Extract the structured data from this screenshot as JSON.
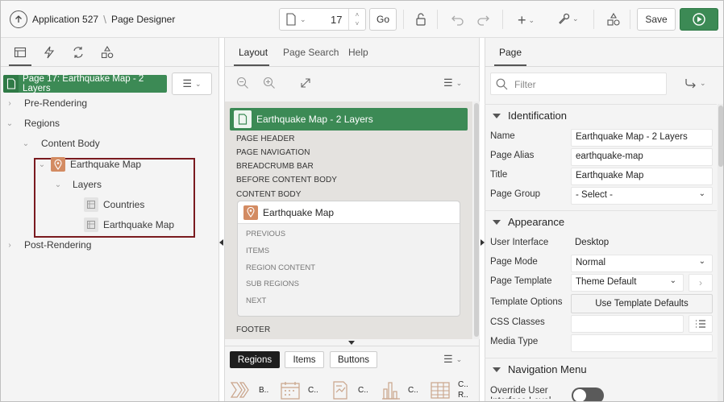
{
  "toolbar": {
    "app_name": "Application 527",
    "separator": "\\",
    "designer_title": "Page Designer",
    "page_number": "17",
    "go_label": "Go",
    "save_label": "Save",
    "colors": {
      "green": "#3c8a55",
      "dark_green": "#2f7a46"
    }
  },
  "left_panel": {
    "tabs": [
      "rendering-icon",
      "dynamic-actions-icon",
      "processing-icon",
      "shared-components-icon"
    ],
    "page_header": "Page 17: Earthquake Map - 2 Layers",
    "tree": {
      "pre_rendering": "Pre-Rendering",
      "regions": "Regions",
      "content_body": "Content Body",
      "earthquake_map": "Earthquake Map",
      "layers": "Layers",
      "countries": "Countries",
      "earthquake_map_layer": "Earthquake Map",
      "post_rendering": "Post-Rendering"
    }
  },
  "middle_panel": {
    "tabs": [
      "Layout",
      "Page Search",
      "Help"
    ],
    "page_title": "Earthquake Map - 2 Layers",
    "positions": {
      "page_header": "PAGE HEADER",
      "page_navigation": "PAGE NAVIGATION",
      "breadcrumb_bar": "BREADCRUMB BAR",
      "before_content_body": "BEFORE CONTENT BODY",
      "content_body": "CONTENT BODY",
      "footer": "FOOTER"
    },
    "region_card": {
      "title": "Earthquake Map",
      "sub_positions": [
        "PREVIOUS",
        "ITEMS",
        "REGION CONTENT",
        "SUB REGIONS",
        "NEXT"
      ]
    },
    "gallery_tabs": [
      "Regions",
      "Items",
      "Buttons"
    ],
    "gallery_items": [
      "B..",
      "C..",
      "C..",
      "C..",
      "C.. R.."
    ]
  },
  "right_panel": {
    "tab": "Page",
    "filter_placeholder": "Filter",
    "identification": {
      "header": "Identification",
      "name_label": "Name",
      "name_value": "Earthquake Map  - 2  Layers",
      "alias_label": "Page Alias",
      "alias_value": "earthquake-map",
      "title_label": "Title",
      "title_value": "Earthquake Map",
      "group_label": "Page Group",
      "group_value": "- Select -"
    },
    "appearance": {
      "header": "Appearance",
      "ui_label": "User Interface",
      "ui_value": "Desktop",
      "mode_label": "Page Mode",
      "mode_value": "Normal",
      "template_label": "Page Template",
      "template_value": "Theme Default",
      "options_label": "Template Options",
      "options_button": "Use Template Defaults",
      "css_label": "CSS Classes",
      "media_label": "Media Type"
    },
    "navigation_menu": {
      "header": "Navigation Menu",
      "override_label": "Override User Interface Level"
    }
  }
}
